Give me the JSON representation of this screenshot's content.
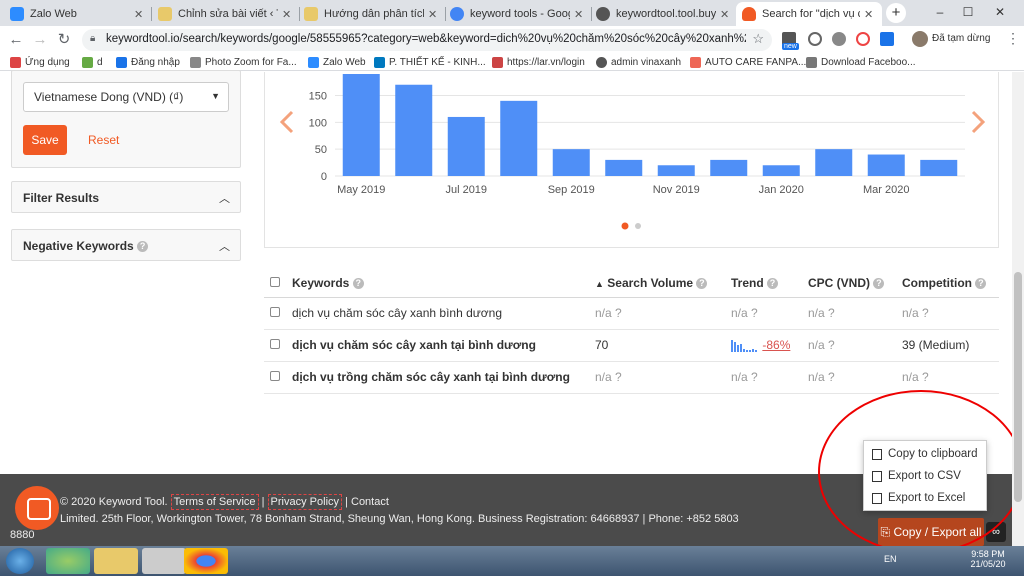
{
  "browser": {
    "tabs": [
      {
        "title": "Zalo Web",
        "color": "#2d8cff"
      },
      {
        "title": "Chỉnh sửa bài viết ‹ Thiết",
        "color": "#e8c96a"
      },
      {
        "title": "Hướng dẫn phân tích từ",
        "color": "#e8c96a"
      },
      {
        "title": "keyword tools - Google",
        "color": "#4285f4"
      },
      {
        "title": "keywordtool.tool.buyseo",
        "color": "#555"
      },
      {
        "title": "Search for \"dịch vụ chăm",
        "color": "#f15a24"
      }
    ],
    "url": "keywordtool.io/search/keywords/google/58555965?category=web&keyword=dich%20vụ%20chăm%20sóc%20cây%20xanh%20bình%2...",
    "profile_label": "Đã tạm dừng",
    "badge_new": "new",
    "bookmarks": [
      "Ứng dụng",
      "d",
      "Đăng nhập",
      "Photo Zoom for Fa...",
      "Zalo Web",
      "P. THIẾT KẾ - KINH...",
      "https://lar.vn/login",
      "admin vinaxanh",
      "AUTO CARE FANPA...",
      "Download Faceboo..."
    ]
  },
  "sidebar": {
    "currency_select": "Vietnamese Dong (VND) (₫)",
    "save_label": "Save",
    "reset_label": "Reset",
    "filter_results_label": "Filter Results",
    "negative_keywords_label": "Negative Keywords"
  },
  "chart_data": {
    "type": "bar",
    "categories": [
      "May 2019",
      "Jun 2019",
      "Jul 2019",
      "Aug 2019",
      "Sep 2019",
      "Oct 2019",
      "Nov 2019",
      "Dec 2019",
      "Jan 2020",
      "Feb 2020",
      "Mar 2020",
      "Apr 2020"
    ],
    "values": [
      190,
      170,
      110,
      140,
      50,
      30,
      20,
      30,
      20,
      50,
      40,
      30
    ],
    "x_tick_labels": [
      "May 2019",
      "Jul 2019",
      "Sep 2019",
      "Nov 2019",
      "Jan 2020",
      "Mar 2020"
    ],
    "y_ticks": [
      0,
      50,
      100,
      150
    ],
    "ylim": [
      0,
      190
    ],
    "color": "#4f8ff7",
    "grid": true
  },
  "table": {
    "headers": {
      "keywords": "Keywords",
      "search_volume": "Search Volume",
      "trend": "Trend",
      "cpc": "CPC (VND)",
      "competition": "Competition"
    },
    "rows": [
      {
        "keyword": "dịch vụ chăm sóc cây xanh bình dương",
        "volume": "n/a ?",
        "trend": "n/a ?",
        "cpc": "n/a ?",
        "competition": "n/a ?"
      },
      {
        "keyword": "dịch vụ chăm sóc cây xanh tại bình dương",
        "volume": "70",
        "trend": "-86%",
        "cpc": "n/a ?",
        "competition": "39 (Medium)"
      },
      {
        "keyword": "dịch vụ trồng chăm sóc cây xanh tại bình dương",
        "volume": "n/a ?",
        "trend": "n/a ?",
        "cpc": "n/a ?",
        "competition": "n/a ?"
      }
    ]
  },
  "export_menu": {
    "copy_clipboard": "Copy to clipboard",
    "export_csv": "Export to CSV",
    "export_excel": "Export to Excel",
    "button_label": "Copy / Export all"
  },
  "footer": {
    "copyright": "© 2020 Keyword Tool.",
    "terms": "Terms of Service",
    "privacy": "Privacy Policy",
    "contact": "Contact",
    "address": "Limited. 25th Floor, Workington Tower, 78 Bonham Strand, Sheung Wan, Hong Kong. Business Registration: 64668937 | Phone: +852 5803",
    "phone_cont": "8880"
  },
  "taskbar": {
    "lang": "EN",
    "time": "9:58 PM",
    "date": "21/05/20"
  }
}
